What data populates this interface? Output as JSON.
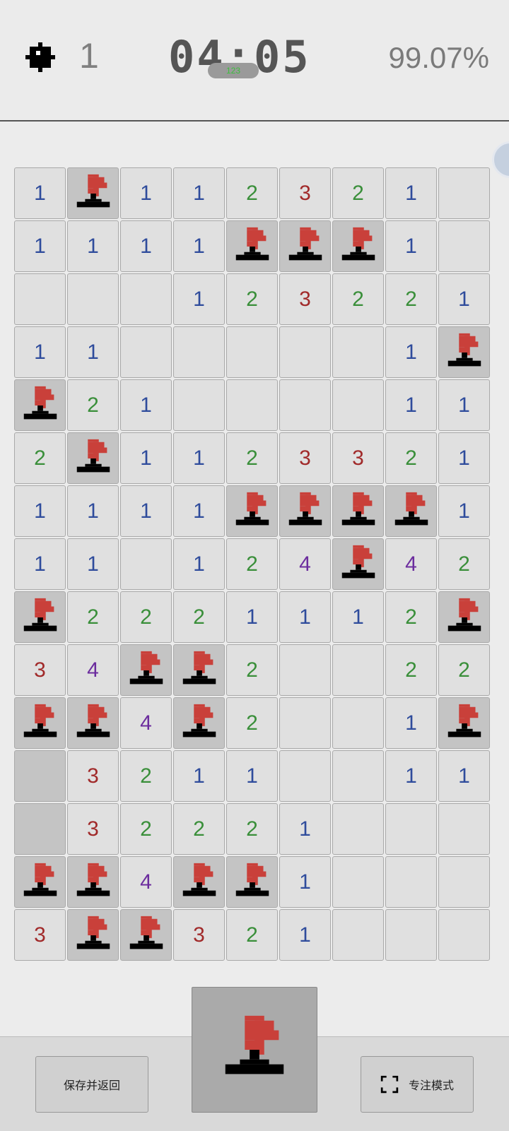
{
  "header": {
    "mine_icon": "mine-icon",
    "mines_remaining": "1",
    "timer": "04:05",
    "timer_pill": "123",
    "progress": "99.07%"
  },
  "board": {
    "rows": 15,
    "cols": 9,
    "legend": {
      "F": "flag",
      "H": "hidden",
      "E": "empty",
      "1-4": "number"
    },
    "grid": [
      [
        "1",
        "F",
        "1",
        "1",
        "2",
        "3",
        "2",
        "1",
        "E"
      ],
      [
        "1",
        "1",
        "1",
        "1",
        "F",
        "F",
        "F",
        "1",
        "E"
      ],
      [
        "E",
        "E",
        "E",
        "1",
        "2",
        "3",
        "2",
        "2",
        "1"
      ],
      [
        "1",
        "1",
        "E",
        "E",
        "E",
        "E",
        "E",
        "1",
        "F"
      ],
      [
        "F",
        "2",
        "1",
        "E",
        "E",
        "E",
        "E",
        "1",
        "1"
      ],
      [
        "2",
        "F",
        "1",
        "1",
        "2",
        "3",
        "3",
        "2",
        "1"
      ],
      [
        "1",
        "1",
        "1",
        "1",
        "F",
        "F",
        "F",
        "F",
        "1"
      ],
      [
        "1",
        "1",
        "E",
        "1",
        "2",
        "4",
        "F",
        "4",
        "2"
      ],
      [
        "F",
        "2",
        "2",
        "2",
        "1",
        "1",
        "1",
        "2",
        "F"
      ],
      [
        "3",
        "4",
        "F",
        "F",
        "2",
        "E",
        "E",
        "2",
        "2"
      ],
      [
        "F",
        "F",
        "4",
        "F",
        "2",
        "E",
        "E",
        "1",
        "F"
      ],
      [
        "H",
        "3",
        "2",
        "1",
        "1",
        "E",
        "E",
        "1",
        "1"
      ],
      [
        "H",
        "3",
        "2",
        "2",
        "2",
        "1",
        "E",
        "E",
        "E"
      ],
      [
        "F",
        "F",
        "4",
        "F",
        "F",
        "1",
        "E",
        "E",
        "E"
      ],
      [
        "3",
        "F",
        "F",
        "3",
        "2",
        "1",
        "E",
        "E",
        "E"
      ]
    ],
    "colors": {
      "1": "#2f4c9c",
      "2": "#3a8f3a",
      "3": "#a12a2a",
      "4": "#6c2d9e",
      "flag": "#c9403a"
    }
  },
  "controls": {
    "save_label": "保存并返回",
    "focus_label": "专注模式",
    "focus_icon": "fullscreen-icon",
    "mode_icon": "flag-icon"
  }
}
